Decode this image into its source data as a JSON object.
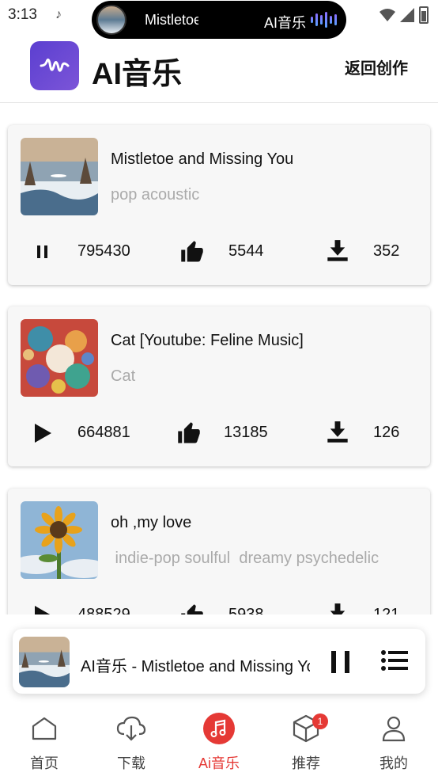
{
  "status_bar": {
    "time": "3:13",
    "island_track": "Mistletoe and Missing You",
    "island_app": "AI音乐"
  },
  "header": {
    "app_title": "AI音乐",
    "back_label": "返回创作"
  },
  "songs": [
    {
      "title": "Mistletoe and Missing You",
      "tags": "pop acoustic",
      "plays": "795430",
      "likes": "5544",
      "downloads": "352",
      "state": "playing"
    },
    {
      "title": "Cat [Youtube: Feline Music]",
      "tags": "Cat",
      "plays": "664881",
      "likes": "13185",
      "downloads": "126",
      "state": "paused"
    },
    {
      "title": "oh ,my love",
      "tags": " indie-pop soulful  dreamy psychedelic",
      "plays": "488529",
      "likes": "5938",
      "downloads": "121",
      "state": "paused"
    }
  ],
  "mini_player": {
    "title": "AI音乐 - Mistletoe and Missing You"
  },
  "nav": {
    "items": [
      {
        "label": "首页",
        "icon": "home-icon"
      },
      {
        "label": "下载",
        "icon": "cloud-download-icon"
      },
      {
        "label": "Ai音乐",
        "icon": "music-note-icon"
      },
      {
        "label": "推荐",
        "icon": "cube-icon"
      },
      {
        "label": "我的",
        "icon": "person-icon"
      }
    ],
    "active_index": 2,
    "recommend_badge": "1"
  },
  "colors": {
    "accent": "#e53935",
    "logo": "#5b3fd0",
    "tag_text": "#aaaaaa"
  }
}
